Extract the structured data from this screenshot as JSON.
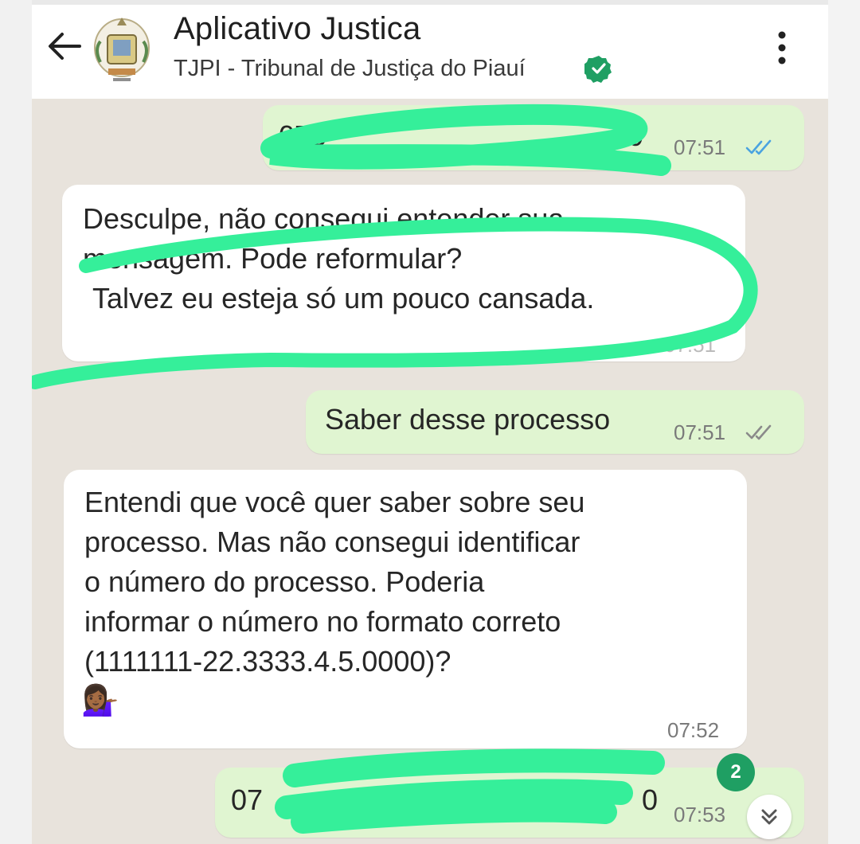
{
  "header": {
    "title": "Aplicativo Justica",
    "subtitle": "TJPI - Tribunal de Justiça do Piauí"
  },
  "messages": [
    {
      "direction": "out",
      "text_visible": "075",
      "text_visible_end": "00",
      "time": "07:51"
    },
    {
      "direction": "in",
      "line1": "Desculpe, não consegui entender sua",
      "line2": "mensagem. Pode reformular?",
      "line3": "Talvez eu esteja só um pouco cansada.",
      "time": "07:51"
    },
    {
      "direction": "out",
      "text": "Saber desse processo",
      "time": "07:51"
    },
    {
      "direction": "in",
      "text": "Entendi que você quer saber sobre seu\nprocesso. Mas não consegui identificar\no número do processo. Poderia\ninformar o número no formato correto\n(1111111-22.3333.4.5.0000)?",
      "emoji": "💁🏾‍♀️",
      "time": "07:52"
    },
    {
      "direction": "out",
      "text_visible": "07",
      "text_visible_end": "0",
      "time": "07:53"
    }
  ],
  "unread_count": "2",
  "colors": {
    "outgoing": "#e0f5d1",
    "incoming": "#ffffff",
    "scribble": "#35ef9a",
    "badge": "#1f9f63",
    "verified": "#1f9f63"
  }
}
